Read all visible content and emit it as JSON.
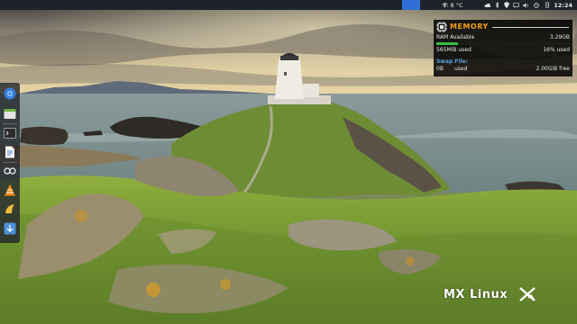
{
  "desktop": {
    "wallpaper_description_icon": "coastal-lighthouse-wallpaper",
    "brand_label": "MX Linux"
  },
  "top_panel": {
    "weather": "T: 8 °C",
    "clock": "12:24",
    "tray_icons": [
      "network-icon",
      "cloud-icon",
      "volume-icon",
      "bluetooth-icon",
      "security-icon",
      "chat-icon",
      "update-icon",
      "clipboard-icon",
      "power-icon"
    ]
  },
  "dock": {
    "items": [
      "chromium-icon",
      "file-manager-icon",
      "terminal-icon",
      "text-editor-icon",
      "tools-icon",
      "vlc-icon",
      "mx-tweak-icon",
      "installer-icon"
    ]
  },
  "memory_widget": {
    "title": "MEMORY",
    "ram_label": "RAM Available",
    "ram_value": "3.29GB",
    "used_amount": "565MiB used",
    "used_percent": "16% used",
    "ram_used_fraction": 0.16,
    "swap_title": "Swap File:",
    "swap_used": "0B",
    "swap_used_label": "used",
    "swap_free": "2.00GiB free"
  },
  "colors": {
    "panel_bg": "#1d2328",
    "accent_orange": "#f3a018",
    "swap_blue": "#5aa0e0",
    "bar_green": "#3cbd46",
    "taskbar_highlight": "#2f6fd6"
  }
}
